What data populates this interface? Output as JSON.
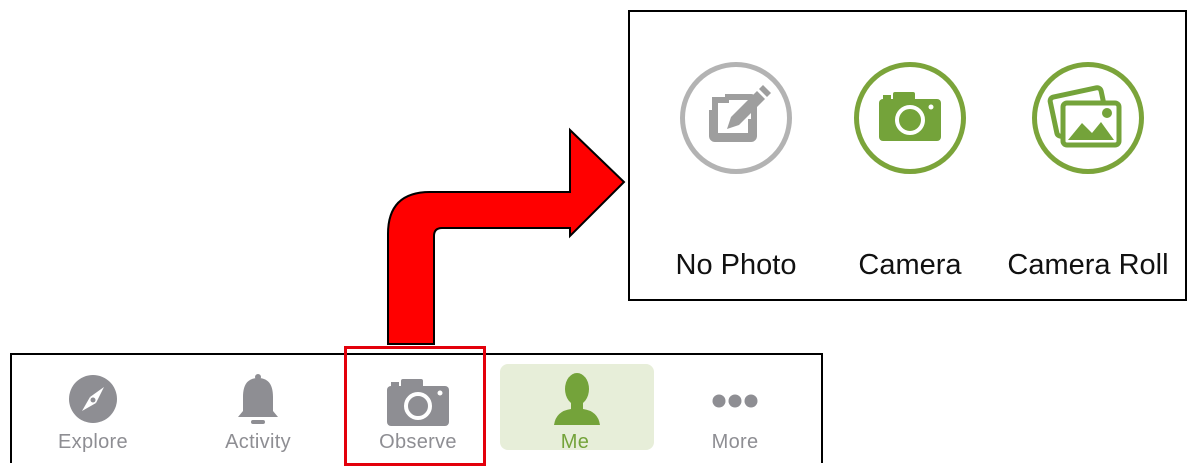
{
  "popup": {
    "options": [
      {
        "label": "No Photo",
        "icon": "edit-square-icon"
      },
      {
        "label": "Camera",
        "icon": "camera-icon"
      },
      {
        "label": "Camera Roll",
        "icon": "photo-gallery-icon"
      }
    ]
  },
  "tabbar": {
    "tabs": [
      {
        "label": "Explore",
        "icon": "compass-icon"
      },
      {
        "label": "Activity",
        "icon": "bell-icon"
      },
      {
        "label": "Observe",
        "icon": "camera-icon"
      },
      {
        "label": "Me",
        "icon": "person-icon",
        "selected": true
      },
      {
        "label": "More",
        "icon": "ellipsis-icon"
      }
    ]
  },
  "colors": {
    "accent_green": "#74a33a",
    "inactive_gray": "#8e8e93",
    "highlight_red": "#e3000b",
    "arrow_red": "#ff0000"
  }
}
